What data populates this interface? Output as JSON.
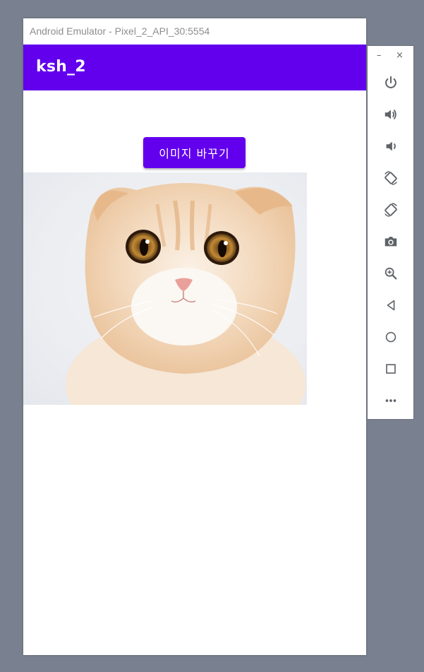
{
  "window": {
    "title": "Android Emulator - Pixel_2_API_30:5554"
  },
  "app": {
    "title": "ksh_2",
    "button_label": "이미지 바꾸기"
  },
  "side_panel": {
    "minimize": "–",
    "close": "×",
    "tools": [
      "power-icon",
      "volume-up-icon",
      "volume-down-icon",
      "rotate-left-icon",
      "rotate-right-icon",
      "camera-icon",
      "zoom-icon",
      "back-icon",
      "home-icon",
      "overview-icon",
      "more-icon"
    ]
  },
  "colors": {
    "accent": "#6200ee",
    "backdrop": "#79808f",
    "icon": "#5f6368"
  }
}
